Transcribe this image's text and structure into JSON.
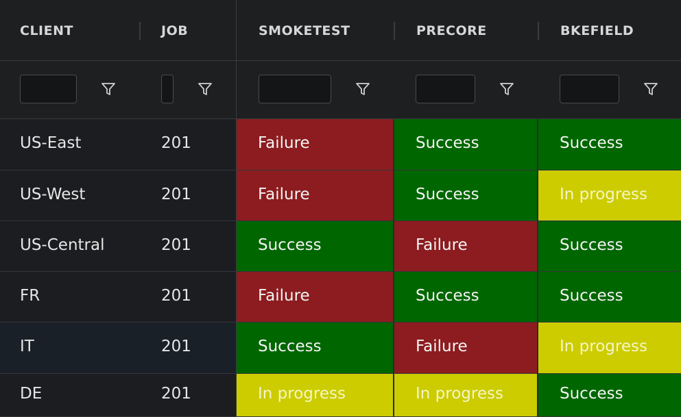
{
  "colors": {
    "failure": "#8c1c1f",
    "success": "#006600",
    "in_progress": "#cccc00",
    "failure_text": "#f4f4f4",
    "success_text": "#f4f4f4",
    "in_progress_text": "#f5f5c8"
  },
  "icons": {
    "filter": "filter-icon"
  },
  "columns": {
    "client": "CLIENT",
    "job": "JOB",
    "smoketest": "SMOKETEST",
    "precore": "PRECORE",
    "bkefield": "BKEFIELD"
  },
  "rows": [
    {
      "client": "US-East",
      "job": "201",
      "smoketest": "Failure",
      "precore": "Success",
      "bkefield": "Success"
    },
    {
      "client": "US-West",
      "job": "201",
      "smoketest": "Failure",
      "precore": "Success",
      "bkefield": "In progress"
    },
    {
      "client": "US-Central",
      "job": "201",
      "smoketest": "Success",
      "precore": "Failure",
      "bkefield": "Success"
    },
    {
      "client": "FR",
      "job": "201",
      "smoketest": "Failure",
      "precore": "Success",
      "bkefield": "Success"
    },
    {
      "client": "IT",
      "job": "201",
      "smoketest": "Success",
      "precore": "Failure",
      "bkefield": "In progress"
    },
    {
      "client": "DE",
      "job": "201",
      "smoketest": "In progress",
      "precore": "In progress",
      "bkefield": "Success"
    }
  ]
}
